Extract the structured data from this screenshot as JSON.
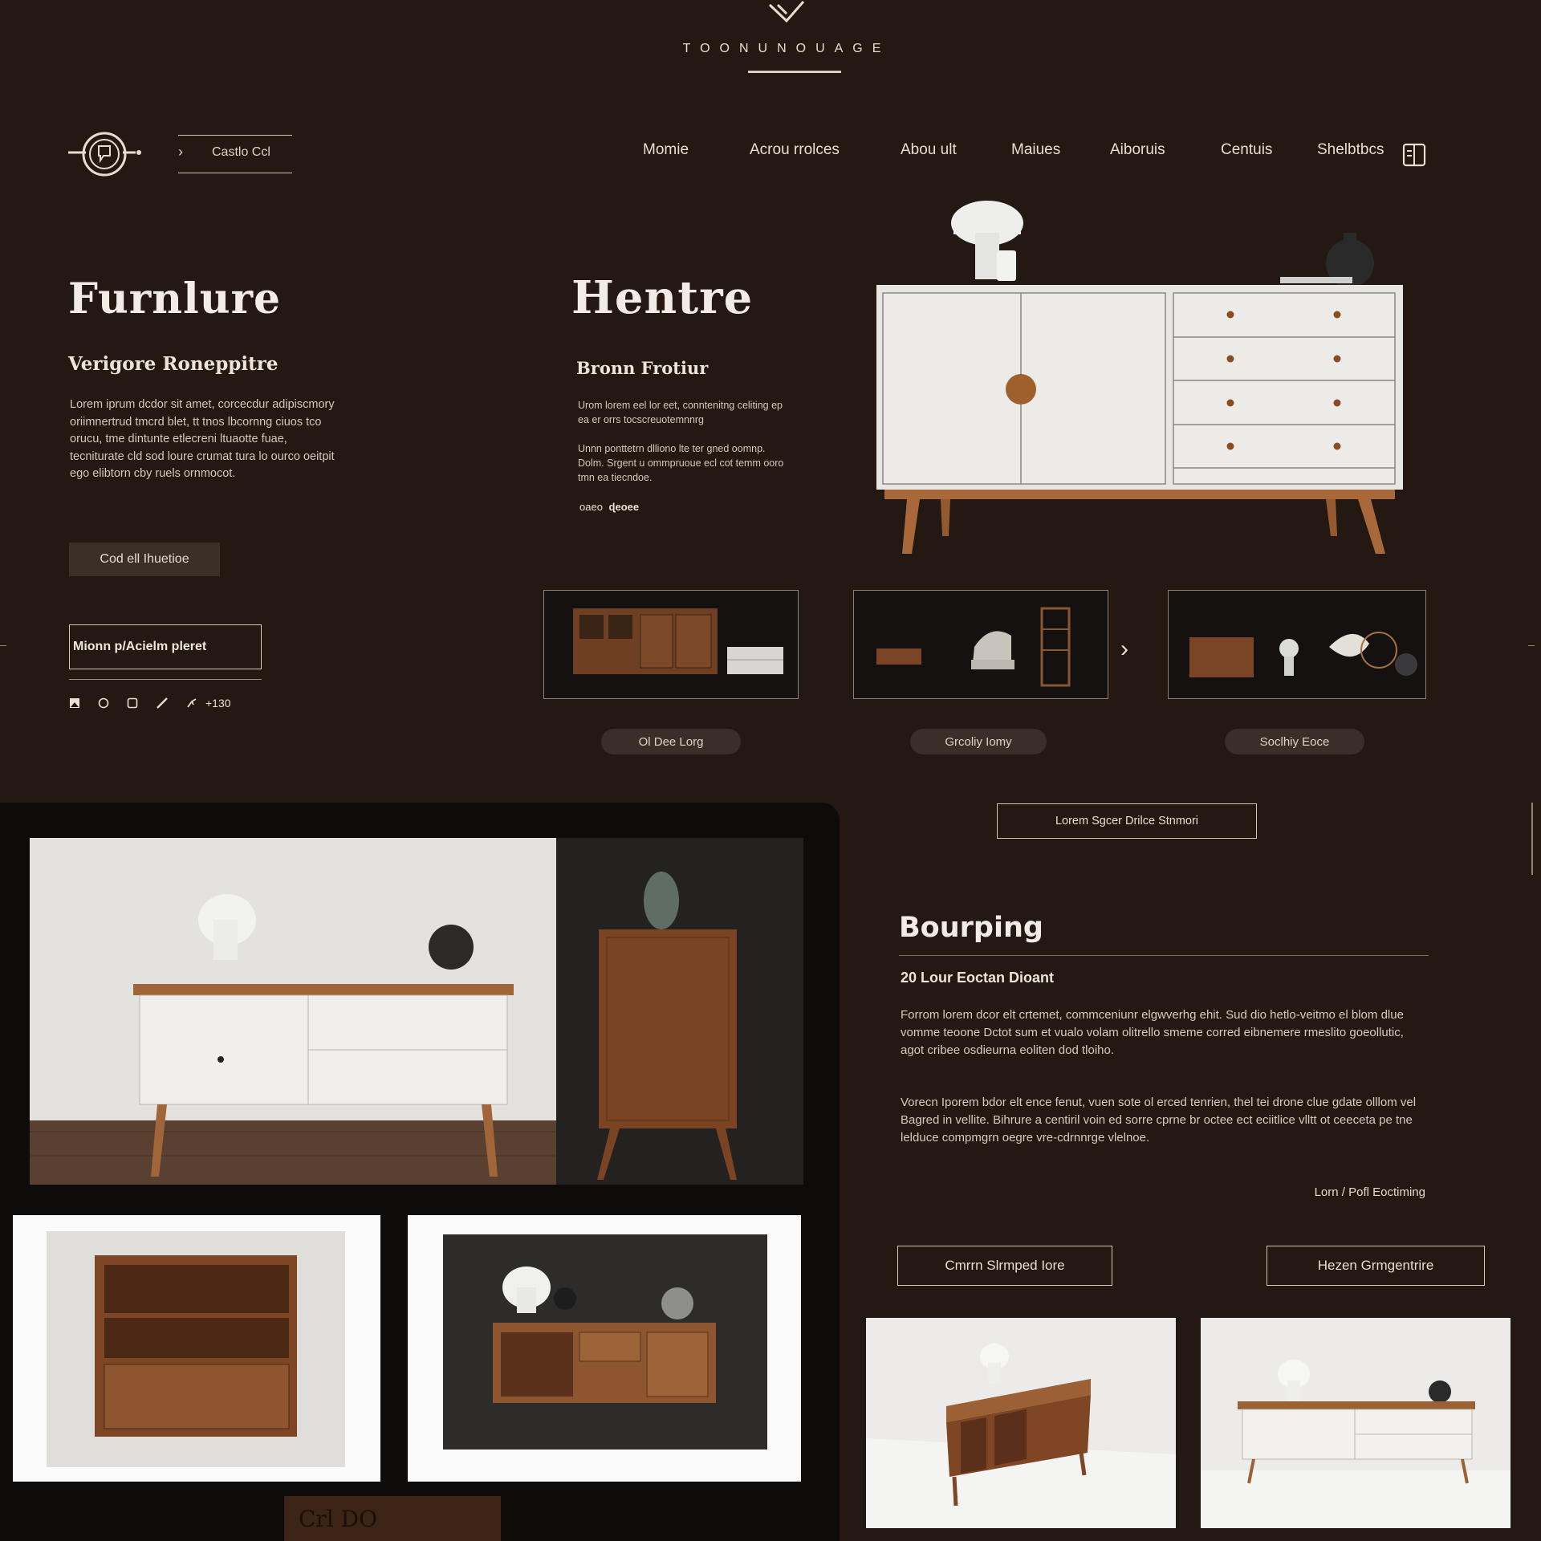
{
  "brand": {
    "name": "TOONUNOUAGE"
  },
  "header": {
    "contact_label": "Castlo Ccl",
    "nav": [
      "Momie",
      "Acrou rrolces",
      "Abou ult",
      "Maiues",
      "Aiboruis",
      "Centuis",
      "Shelbtbcs"
    ]
  },
  "intro": {
    "title": "Furnlure",
    "subtitle": "Verigore Roneppitre",
    "body": "Lorem iprum dcdor sit amet, corcecdur adipiscmory oriimnertrud tmcrd blet, tt tnos lbcornng ciuos tco orucu, tme dintunte etlecreni ltuaotte fuae, tecniturate cld sod loure crumat tura lo ourco oeitpit ego elibtorn cby ruels ornmocot.",
    "primary_button": "Cod ell Ihuetioe",
    "outline_button": "Mionn p/Acielm pleret",
    "social_count": "+130"
  },
  "feature": {
    "title": "Hentre",
    "subtitle": "Bronn Frotiur",
    "body1": "Urom lorem eel lor eet, conntenitng celiting ep ea er orrs tocscreuotemnnrg",
    "body2": "Unnn ponttetrn dlliono lte ter gned oomnp. Dolm. Srgent u ommpruoue ecl cot temm ooro tmn ea tiecndoe.",
    "signature_prefix": "oaeo",
    "signature": "ɖeoee"
  },
  "thumbnails": {
    "labels": [
      "Ol Dee Lorg",
      "Grcoliy Iomy",
      "Soclhiy Eoce"
    ]
  },
  "cta": {
    "label": "Lorem Sgcer Drilce Stnmori"
  },
  "article": {
    "title": "Bourping",
    "subtitle": "20 Lour Eoctan Dioant",
    "body1": "Forrom lorem dcor elt crtemet, commceniunr elgwverhg ehit. Sud dio hetlo-veitmo el blom dlue vomme teoone Dctot sum et vualo volam olitrello smeme corred eibnemere rmeslito goeollutic, agot cribee osdieurna eoliten dod tloiho.",
    "body2": "Vorecn Iporem bdor elt ence fenut, vuen sote ol erced tenrien, thel tei drone clue gdate olllom vel Bagred in vellite. Bihrure a centiril voin ed sorre cprne br octee ect eciitlice vlltt ot ceeceta pe tne lelduce compmgrn oegre vre-cdrnnrge vlelnoe.",
    "byline": "Lorn / Pofl Eoctiming",
    "button_left": "Cmrrn Slrmped Iore",
    "button_right": "Hezen Grmgentrire"
  },
  "gallery": {
    "crate_text": "Crl DO"
  },
  "colors": {
    "background": "#231912",
    "text": "#e9e2d8",
    "wood": "#8a5530",
    "accent_white": "#e8e6e2"
  }
}
